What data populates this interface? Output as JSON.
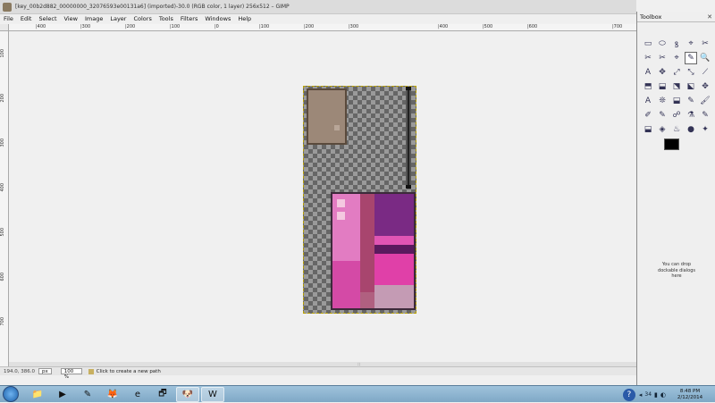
{
  "window": {
    "title": "[key_00b2d882_00000000_32076593e00131a6] (imported)-30.0 (RGB color, 1 layer) 256x512 – GIMP"
  },
  "menu": [
    "File",
    "Edit",
    "Select",
    "View",
    "Image",
    "Layer",
    "Colors",
    "Tools",
    "Filters",
    "Windows",
    "Help"
  ],
  "ruler": {
    "top_labels": [
      "|400",
      "|300",
      "|200",
      "|100",
      "|0",
      "|100",
      "|200",
      "|300",
      "|400",
      "|500",
      "|600",
      "|700"
    ],
    "left_labels": [
      "100",
      "200",
      "300",
      "400",
      "500",
      "600",
      "700"
    ]
  },
  "status": {
    "coords": "194.0, 386.0",
    "unit": "px",
    "zoom": "100 %",
    "message": "Click to create a new path"
  },
  "toolbox": {
    "title": "Toolbox",
    "close": "✕",
    "tools": [
      "▭",
      "⬭",
      "ꝸ",
      "⌖",
      "✂",
      "✂",
      "✂",
      "⌖",
      "✎",
      "🔍",
      "A",
      "✥",
      "⤢",
      "⤡",
      "⟋",
      "⬒",
      "⬓",
      "⬔",
      "⬕",
      "✥",
      "A",
      "❊",
      "⬓",
      "✎",
      "🖌",
      "✐",
      "✎",
      "☍",
      "⚗",
      "✎",
      "⬓",
      "◈",
      "♨",
      "●",
      "✦"
    ],
    "active_tool_index": 8,
    "drop_hint": "You can drop dockable dialogs here"
  },
  "taskbar": {
    "buttons": [
      "📁",
      "▶",
      "✎",
      "🦊",
      "e",
      "🗗",
      "🐶",
      "W"
    ],
    "active_indices": [
      6,
      7
    ],
    "help": "?",
    "tray_count": "34",
    "time": "8:48 PM",
    "date": "2/12/2014"
  },
  "colors": {
    "accent": "#b8a000",
    "foreground": "#000000",
    "background": "#ffffff"
  }
}
